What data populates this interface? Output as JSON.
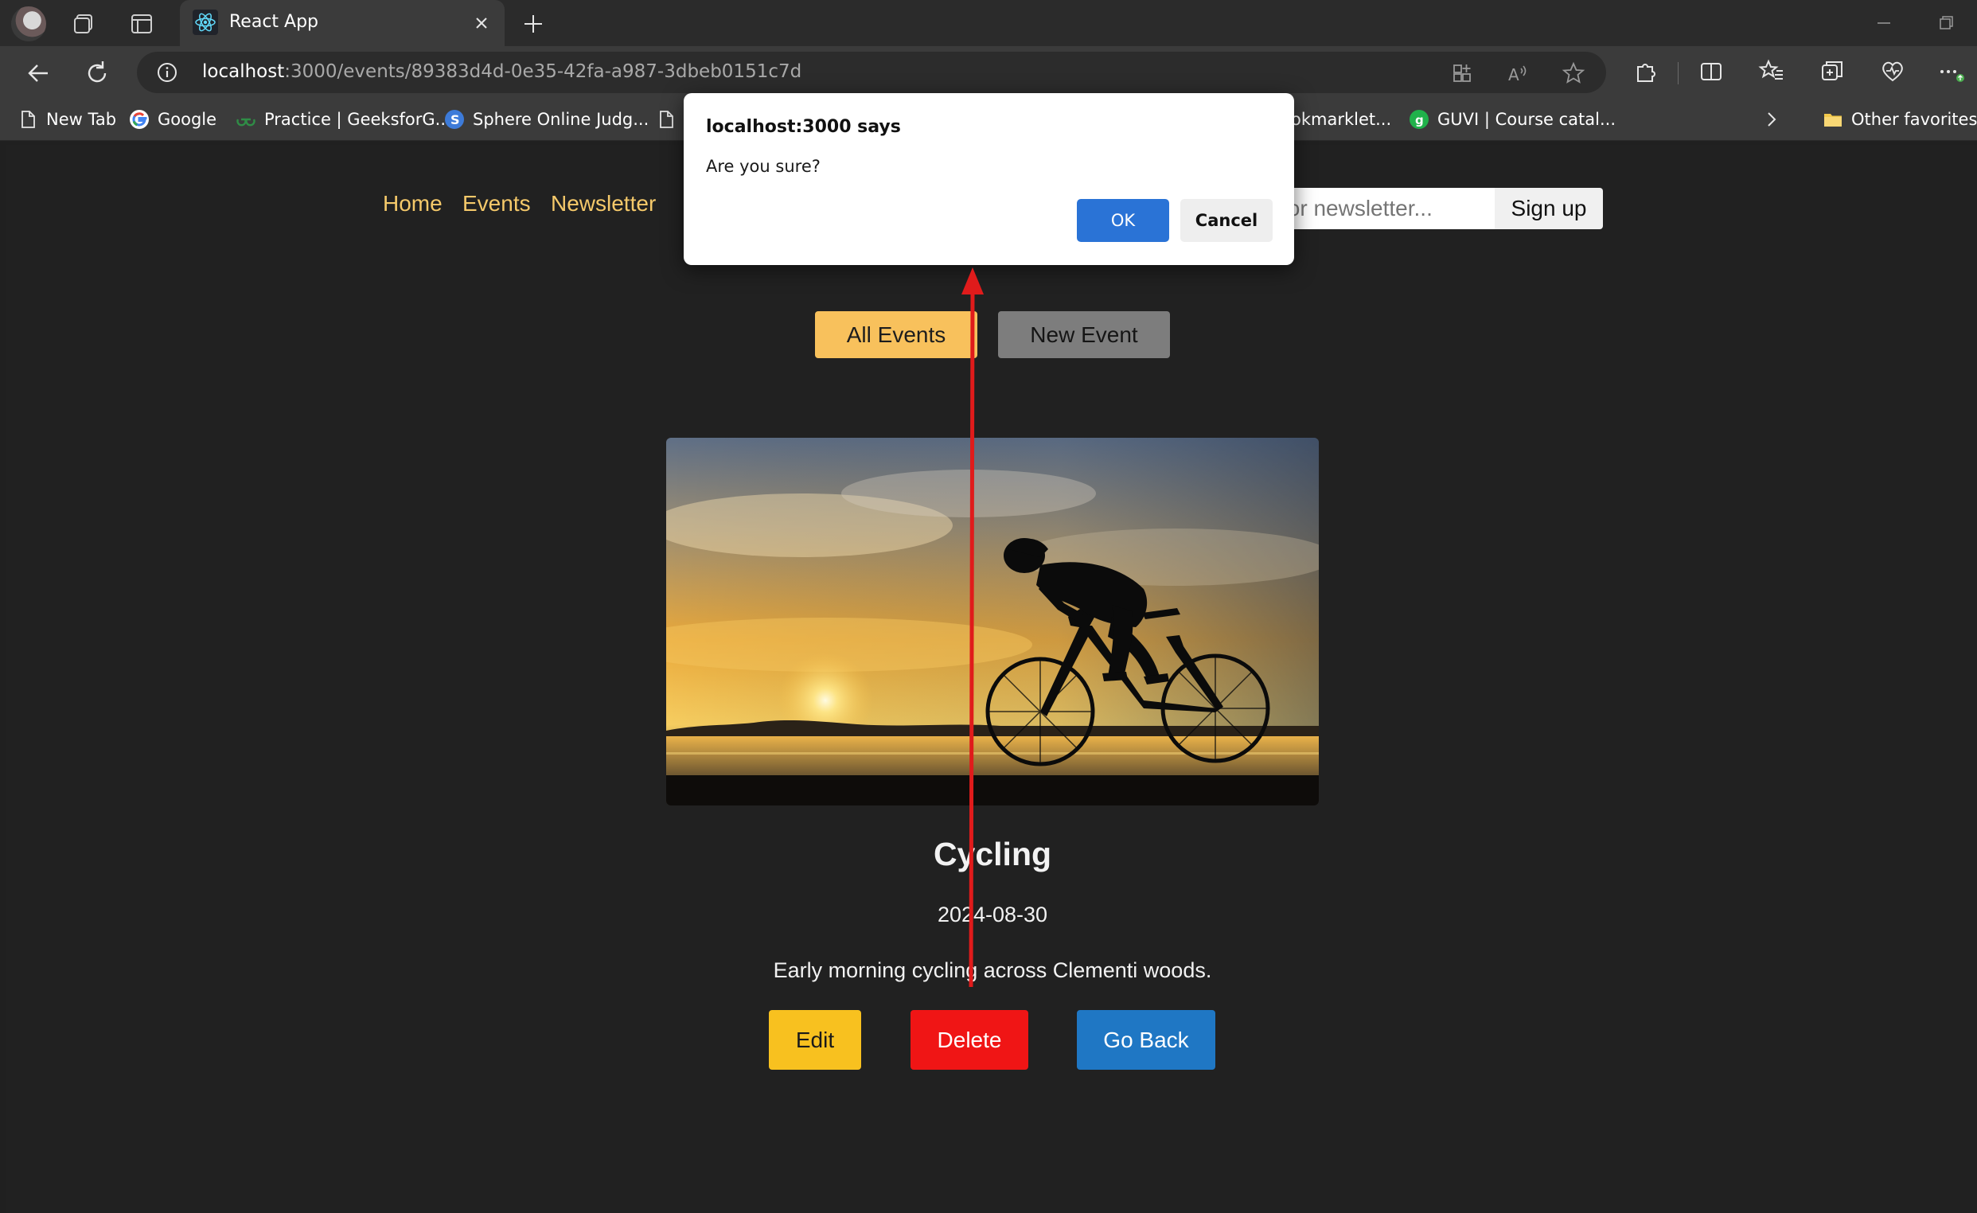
{
  "browser": {
    "tab_title": "React App",
    "url_host": "localhost",
    "url_rest": ":3000/events/89383d4d-0e35-42fa-a987-3dbeb0151c7d",
    "favorites": [
      {
        "label": "New Tab",
        "icon": "page-icon"
      },
      {
        "label": "Google",
        "icon": "google-icon"
      },
      {
        "label": "Practice | GeeksforG...",
        "icon": "geeksforgeeks-icon"
      },
      {
        "label": "Sphere Online Judg...",
        "icon": "spoj-icon"
      },
      {
        "label": "",
        "icon": "page-icon"
      },
      {
        "label": "okmarklet...",
        "icon": ""
      },
      {
        "label": "GUVI | Course catal...",
        "icon": "guvi-icon"
      }
    ],
    "other_favorites": "Other favorites"
  },
  "nav": {
    "home": "Home",
    "events": "Events",
    "newsletter": "Newsletter",
    "newsletter_placeholder": "for newsletter...",
    "signup": "Sign up"
  },
  "subnav": {
    "all_events": "All Events",
    "new_event": "New Event"
  },
  "event": {
    "image_subject": "cyclist silhouette at sunset",
    "title": "Cycling",
    "date": "2024-08-30",
    "description": "Early morning cycling across Clementi woods.",
    "edit": "Edit",
    "delete": "Delete",
    "go_back": "Go Back"
  },
  "dialog": {
    "title": "localhost:3000 says",
    "message": "Are you sure?",
    "ok": "OK",
    "cancel": "Cancel"
  },
  "colors": {
    "accent_yellow": "#f8c15c",
    "delete_red": "#f01515",
    "go_back_blue": "#1f77c4",
    "dialog_ok_blue": "#2a73d6",
    "annotation_arrow": "#e01b1b"
  }
}
